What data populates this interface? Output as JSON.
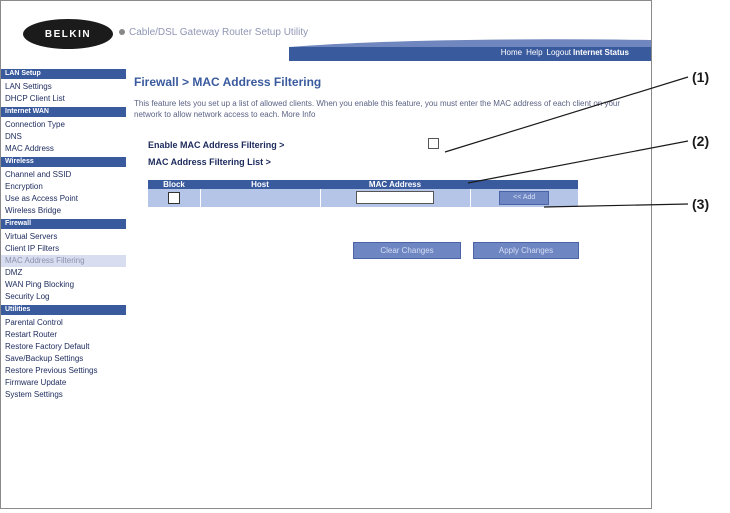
{
  "header": {
    "logo_text": "BELKIN",
    "title": "Cable/DSL Gateway Router Setup Utility",
    "nav_links": [
      "Home",
      "Help",
      "Logout"
    ],
    "status_link": "Internet Status"
  },
  "sidebar": {
    "sections": [
      {
        "heading": "LAN Setup",
        "items": [
          "LAN Settings",
          "DHCP Client List"
        ]
      },
      {
        "heading": "Internet WAN",
        "items": [
          "Connection Type",
          "DNS",
          "MAC Address"
        ]
      },
      {
        "heading": "Wireless",
        "items": [
          "Channel and SSID",
          "Encryption",
          "Use as Access Point",
          "Wireless Bridge"
        ]
      },
      {
        "heading": "Firewall",
        "items": [
          "Virtual Servers",
          "Client IP Filters",
          "MAC Address Filtering",
          "DMZ",
          "WAN Ping Blocking",
          "Security Log"
        ]
      },
      {
        "heading": "Utilities",
        "items": [
          "Parental Control",
          "Restart Router",
          "Restore Factory Default",
          "Save/Backup Settings",
          "Restore Previous Settings",
          "Firmware Update",
          "System Settings"
        ]
      }
    ],
    "active_item": "MAC Address Filtering"
  },
  "main": {
    "title": "Firewall > MAC Address Filtering",
    "description": "This feature lets you set up a list of allowed clients. When you enable this feature, you must enter the MAC address of each client on your network to allow network access to each. More Info",
    "enable_label": "Enable MAC Address Filtering >",
    "list_label": "MAC Address Filtering List >",
    "table": {
      "headers": [
        "Block",
        "Host",
        "MAC Address",
        ""
      ],
      "add_label": "<< Add"
    },
    "clear_label": "Clear Changes",
    "apply_label": "Apply Changes"
  },
  "callouts": [
    "(1)",
    "(2)",
    "(3)"
  ],
  "colors": {
    "nav_blue": "#3a5a9e",
    "row_blue": "#b5c5e8",
    "title_blue": "#3a5a9e"
  }
}
